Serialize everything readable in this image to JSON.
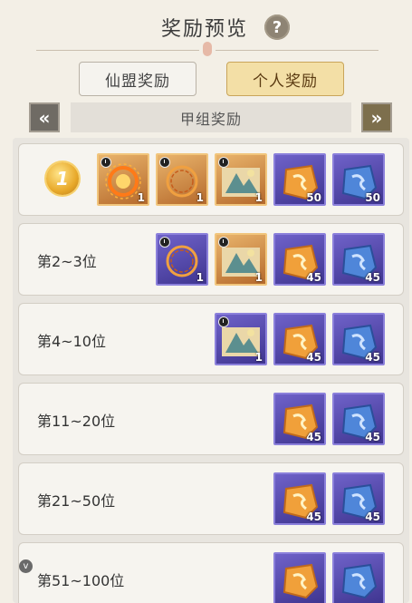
{
  "header": {
    "title": "奖励预览",
    "help": "?"
  },
  "tabs": [
    {
      "label": "仙盟奖励",
      "active": false
    },
    {
      "label": "个人奖励",
      "active": true
    }
  ],
  "group_nav": {
    "prev": "«",
    "label": "甲组奖励",
    "next": "»"
  },
  "ranks": [
    {
      "label": "1",
      "medal": true,
      "items": [
        {
          "kind": "gold",
          "icon": "fire-ring-icon",
          "count": "1",
          "timed": true
        },
        {
          "kind": "gold",
          "icon": "flame-hoop-icon",
          "count": "1",
          "timed": true
        },
        {
          "kind": "gold",
          "icon": "mountain-scroll-icon",
          "count": "1",
          "timed": true
        },
        {
          "kind": "purple",
          "icon": "orange-stone-icon",
          "count": "50",
          "timed": false
        },
        {
          "kind": "purple",
          "icon": "blue-stone-icon",
          "count": "50",
          "timed": false
        }
      ]
    },
    {
      "label": "第2~3位",
      "medal": false,
      "items": [
        {
          "kind": "purple",
          "icon": "flame-hoop-icon",
          "count": "1",
          "timed": true
        },
        {
          "kind": "gold",
          "icon": "mountain-scroll-icon",
          "count": "1",
          "timed": true
        },
        {
          "kind": "purple",
          "icon": "orange-stone-icon",
          "count": "45",
          "timed": false
        },
        {
          "kind": "purple",
          "icon": "blue-stone-icon",
          "count": "45",
          "timed": false
        }
      ]
    },
    {
      "label": "第4~10位",
      "medal": false,
      "items": [
        {
          "kind": "purple",
          "icon": "mountain-scroll-icon",
          "count": "1",
          "timed": true
        },
        {
          "kind": "purple",
          "icon": "orange-stone-icon",
          "count": "45",
          "timed": false
        },
        {
          "kind": "purple",
          "icon": "blue-stone-icon",
          "count": "45",
          "timed": false
        }
      ]
    },
    {
      "label": "第11~20位",
      "medal": false,
      "items": [
        {
          "kind": "purple",
          "icon": "orange-stone-icon",
          "count": "45",
          "timed": false
        },
        {
          "kind": "purple",
          "icon": "blue-stone-icon",
          "count": "45",
          "timed": false
        }
      ]
    },
    {
      "label": "第21~50位",
      "medal": false,
      "items": [
        {
          "kind": "purple",
          "icon": "orange-stone-icon",
          "count": "45",
          "timed": false
        },
        {
          "kind": "purple",
          "icon": "blue-stone-icon",
          "count": "45",
          "timed": false
        }
      ]
    },
    {
      "label": "第51~100位",
      "medal": false,
      "items": [
        {
          "kind": "purple",
          "icon": "orange-stone-icon",
          "count": "",
          "timed": false
        },
        {
          "kind": "purple",
          "icon": "blue-stone-icon",
          "count": "",
          "timed": false
        }
      ]
    }
  ],
  "scroll_badge": "v"
}
